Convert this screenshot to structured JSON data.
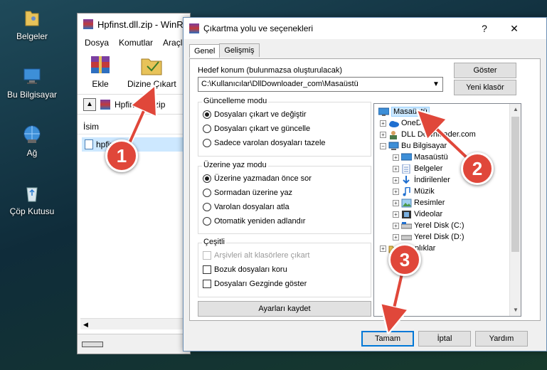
{
  "desktop": {
    "icons": [
      {
        "label": "Belgeler",
        "icon": "folder-user-icon"
      },
      {
        "label": "Bu Bilgisayar",
        "icon": "computer-icon"
      },
      {
        "label": "Ağ",
        "icon": "network-icon"
      },
      {
        "label": "Çöp Kutusu",
        "icon": "recycle-bin-icon"
      }
    ]
  },
  "winrar": {
    "title": "Hpfinst.dll.zip - WinR",
    "menu": [
      "Dosya",
      "Komutlar",
      "Araçla"
    ],
    "tools": [
      "Ekle",
      "Dizine Çıkart"
    ],
    "path": "Hpfinst.dll.zip",
    "column_name": "İsim",
    "file_name": "hpfinst.dll",
    "scroll_left": "◀"
  },
  "dialog": {
    "title": "Çıkartma yolu ve seçenekleri",
    "help": "?",
    "close": "✕",
    "tabs": [
      "Genel",
      "Gelişmiş"
    ],
    "dest_label": "Hedef konum (bulunmazsa oluşturulacak)",
    "dest_value": "C:\\Kullanıcılar\\DllDownloader_com\\Masaüstü",
    "show_button": "Göster",
    "new_folder_button": "Yeni klasör",
    "update_mode": {
      "title": "Güncelleme modu",
      "options": [
        "Dosyaları çıkart ve değiştir",
        "Dosyaları çıkart ve güncelle",
        "Sadece varolan dosyaları tazele"
      ],
      "selected": 0
    },
    "overwrite_mode": {
      "title": "Üzerine yaz modu",
      "options": [
        "Üzerine yazmadan önce sor",
        "Sormadan üzerine yaz",
        "Varolan dosyaları atla",
        "Otomatik yeniden adlandır"
      ],
      "selected": 0
    },
    "misc": {
      "title": "Çeşitli",
      "options": [
        "Arşivleri alt klasörlere çıkart",
        "Bozuk dosyaları koru",
        "Dosyaları Gezginde göster"
      ],
      "disabled": [
        true,
        false,
        false
      ]
    },
    "save_settings": "Ayarları kaydet",
    "ok": "Tamam",
    "cancel": "İptal",
    "help_button": "Yardım",
    "tree": [
      {
        "label": "Masaüstü",
        "selected": true,
        "icon": "desktop-icon"
      },
      {
        "label": "OneDrive",
        "icon": "onedrive-icon"
      },
      {
        "label": "DLL Downloader.com",
        "icon": "user-icon"
      },
      {
        "label": "Bu Bilgisayar",
        "icon": "computer-icon"
      },
      {
        "label": "Masaüstü",
        "icon": "desktop-icon"
      },
      {
        "label": "Belgeler",
        "icon": "documents-icon"
      },
      {
        "label": "İndirilenler",
        "icon": "download-icon"
      },
      {
        "label": "Müzik",
        "icon": "music-icon"
      },
      {
        "label": "Resimler",
        "icon": "pictures-icon"
      },
      {
        "label": "Videolar",
        "icon": "videos-icon"
      },
      {
        "label": "Yerel Disk (C:)",
        "icon": "drive-icon"
      },
      {
        "label": "Yerel Disk (D:)",
        "icon": "drive-icon"
      },
      {
        "label": "Kitaplıklar",
        "icon": "libraries-icon"
      }
    ]
  },
  "annotations": {
    "steps": [
      "1",
      "2",
      "3"
    ],
    "color": "#e0473a"
  }
}
